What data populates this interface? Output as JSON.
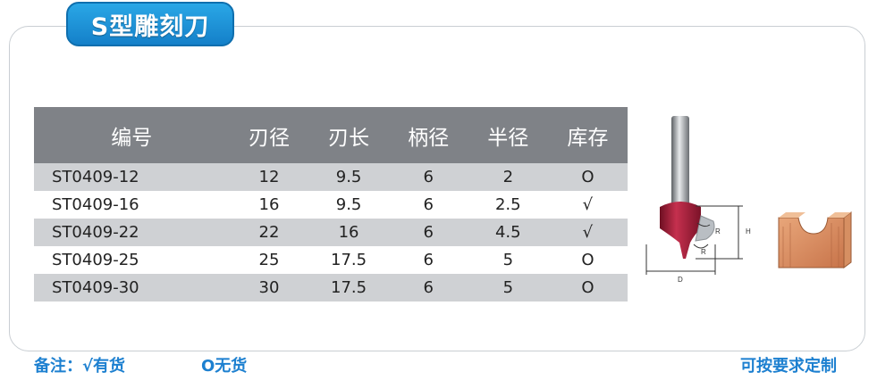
{
  "title": "S型雕刻刀",
  "table": {
    "headers": [
      "编号",
      "刃径",
      "刃长",
      "柄径",
      "半径",
      "库存"
    ],
    "rows": [
      [
        "ST0409-12",
        "12",
        "9.5",
        "6",
        "2",
        "O"
      ],
      [
        "ST0409-16",
        "16",
        "9.5",
        "6",
        "2.5",
        "√"
      ],
      [
        "ST0409-22",
        "22",
        "16",
        "6",
        "4.5",
        "√"
      ],
      [
        "ST0409-25",
        "25",
        "17.5",
        "6",
        "5",
        "O"
      ],
      [
        "ST0409-30",
        "30",
        "17.5",
        "6",
        "5",
        "O"
      ]
    ]
  },
  "diagram": {
    "h_label": "H",
    "d_label": "D",
    "r_label": "R"
  },
  "footer": {
    "note": "备注：√有货",
    "none": "O无货",
    "custom": "可按要求定制"
  },
  "colors": {
    "accent": "#1d80d0",
    "header_bg": "#7f8287",
    "row_alt": "#cfd1d4",
    "bit": "#a8213a"
  }
}
